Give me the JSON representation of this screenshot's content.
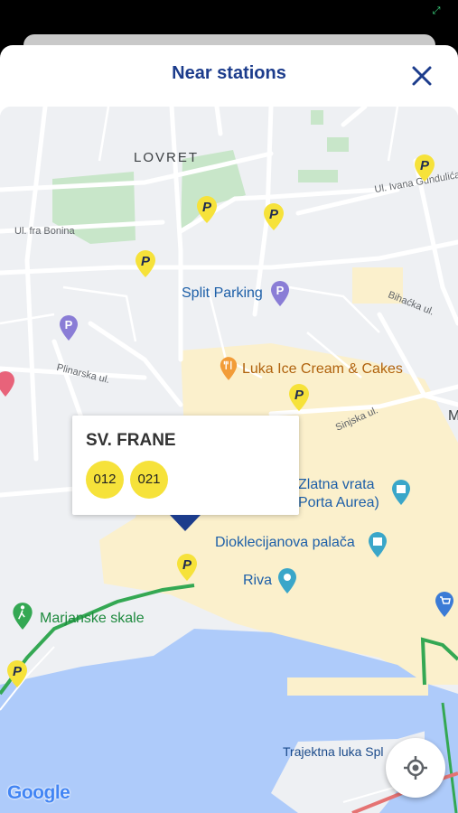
{
  "header": {
    "title": "Near stations"
  },
  "map": {
    "area_labels": {
      "lovret": "LOVRET"
    },
    "streets": {
      "ivana_gundulica": "Ul. Ivana Gundulića",
      "fra_bonina": "Ul. fra Bonina",
      "bihacka": "Bihaćka ul.",
      "plinarska": "Plinarska ul.",
      "sinjska": "Sinjska ul."
    },
    "pois": {
      "split_parking": "Split Parking",
      "luka_ice_cream": "Luka Ice Cream & Cakes",
      "zlatna_vrata_1": "Zlatna vrata",
      "zlatna_vrata_2": "Porta Aurea)",
      "dioklecijanova": "Dioklecijanova palača",
      "riva": "Riva",
      "marjanske_skale": "Marjanske skale",
      "trajektna": "Trajektna luka Spl",
      "edge_m": "M"
    },
    "attribution": "Google",
    "colors": {
      "water": "#aecbfa",
      "old_town": "#fbf0cc",
      "park": "#c8e6c9",
      "pin": "#f6e23a",
      "accent": "#1c3c8c"
    }
  },
  "callout": {
    "station_name": "SV. FRANE",
    "routes": [
      "012",
      "021"
    ]
  }
}
